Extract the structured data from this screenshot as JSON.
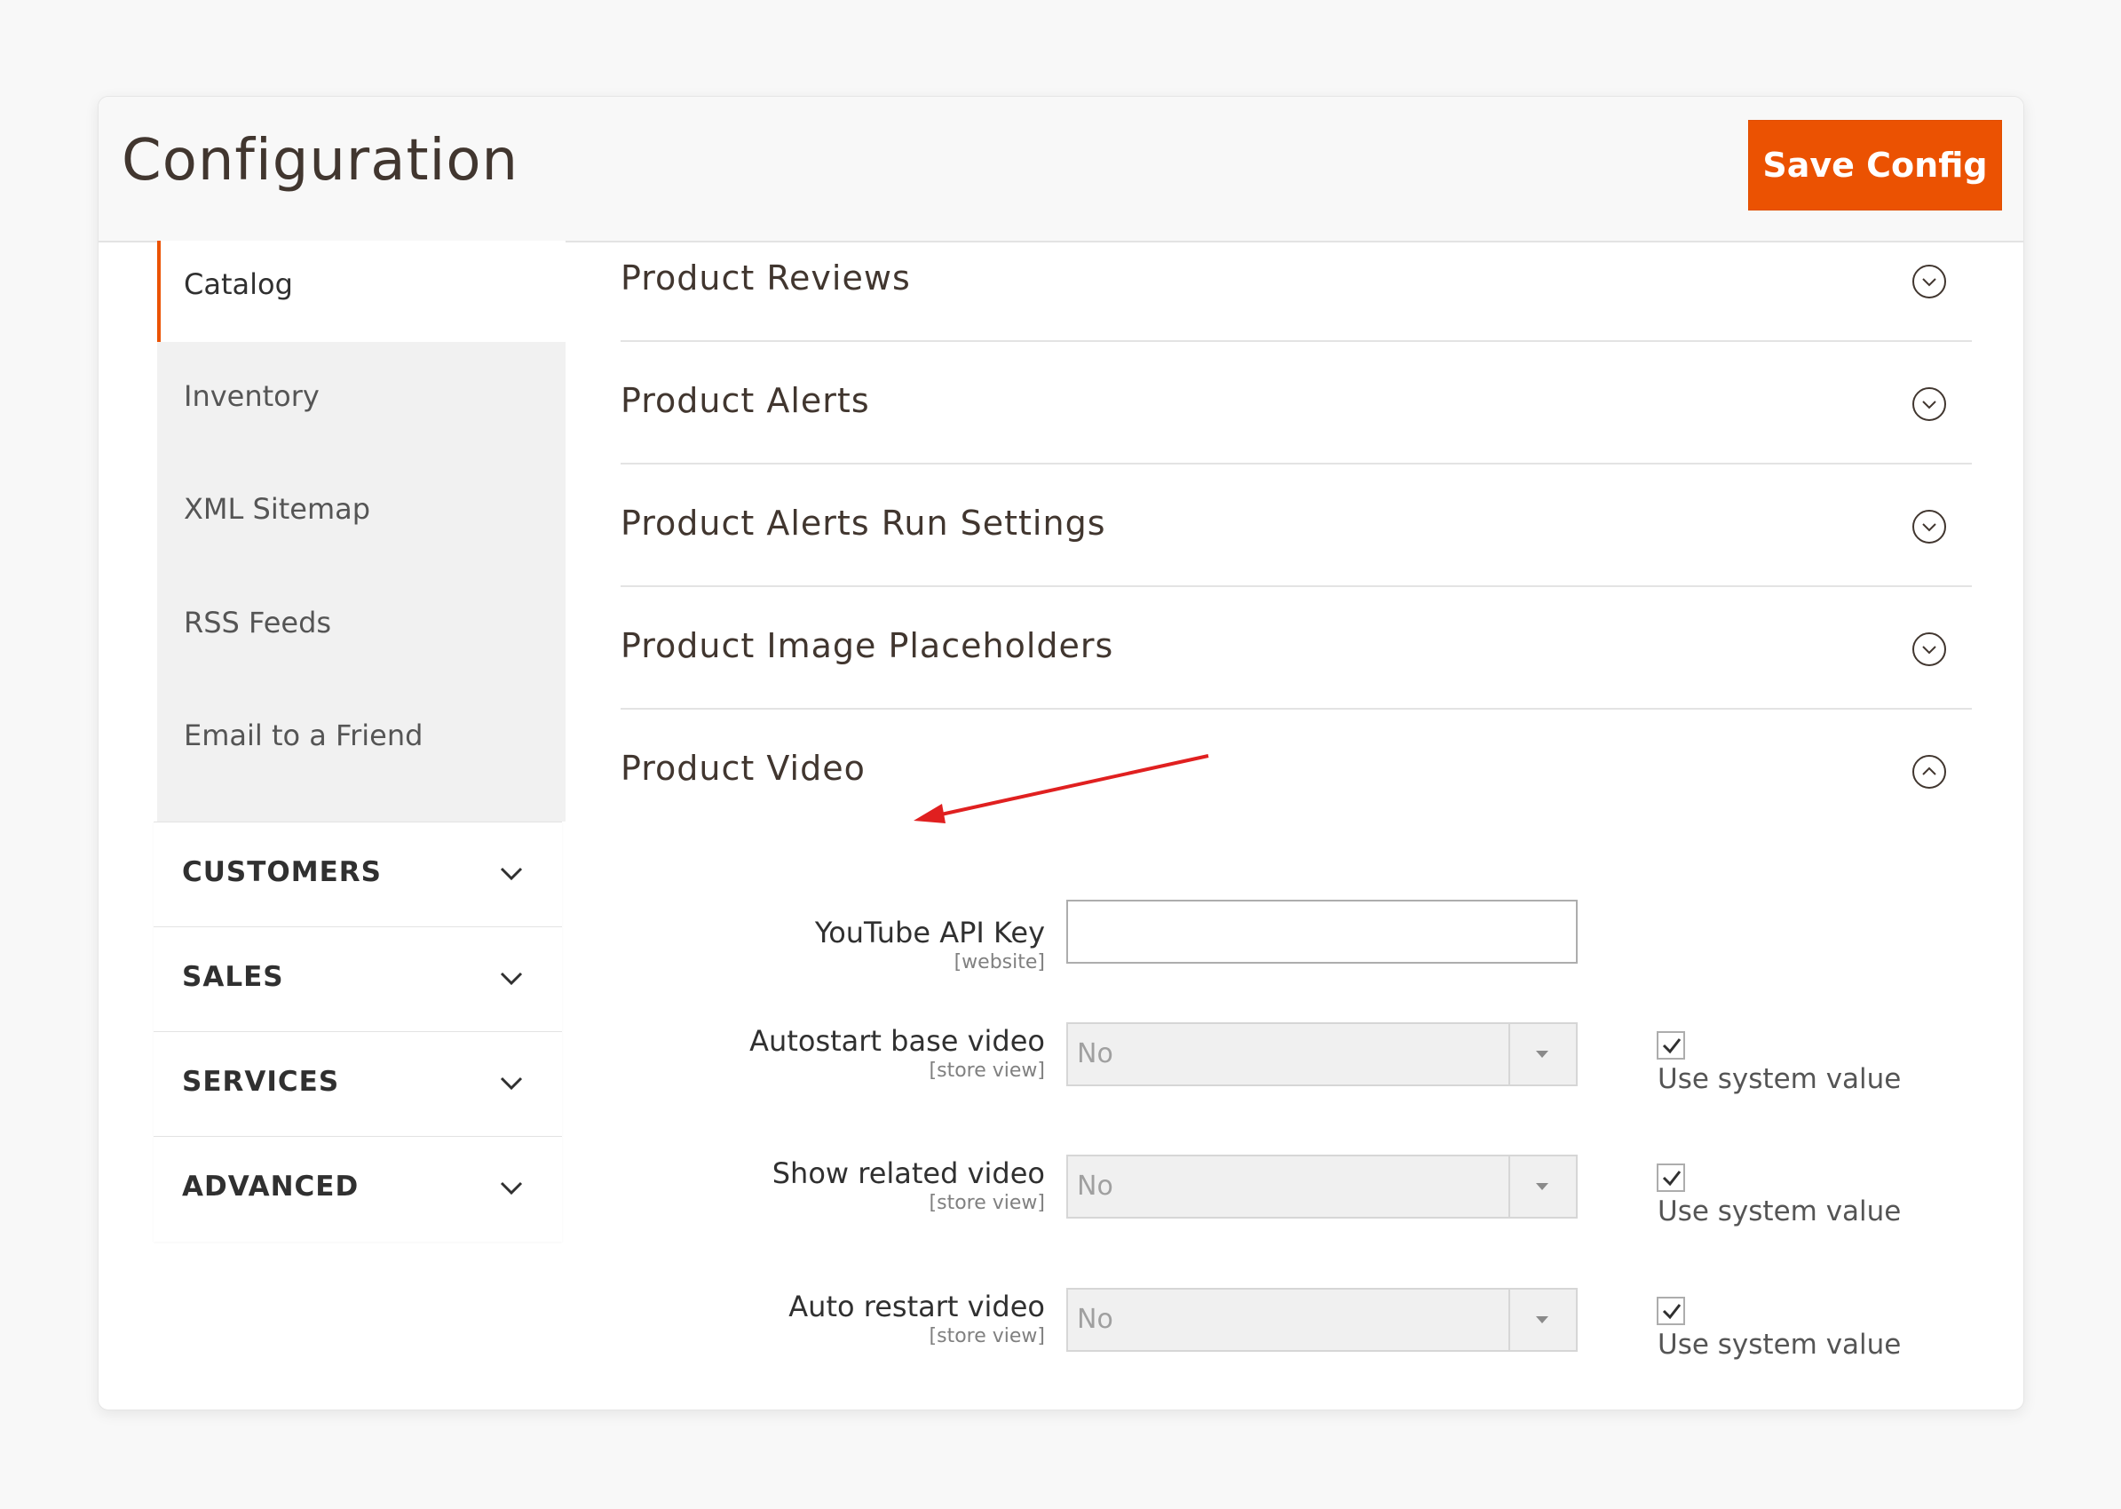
{
  "header": {
    "title": "Configuration",
    "save_label": "Save Config"
  },
  "sidebar": {
    "active_item": "Catalog",
    "sub_items": [
      "Inventory",
      "XML Sitemap",
      "RSS Feeds",
      "Email to a Friend"
    ],
    "sections": [
      "CUSTOMERS",
      "SALES",
      "SERVICES",
      "ADVANCED"
    ]
  },
  "groups": [
    {
      "title": "Product Reviews",
      "expanded": false
    },
    {
      "title": "Product Alerts",
      "expanded": false
    },
    {
      "title": "Product Alerts Run Settings",
      "expanded": false
    },
    {
      "title": "Product Image Placeholders",
      "expanded": false
    },
    {
      "title": "Product Video",
      "expanded": true
    }
  ],
  "product_video": {
    "fields": [
      {
        "label": "YouTube API Key",
        "scope": "[website]",
        "type": "text",
        "value": ""
      },
      {
        "label": "Autostart base video",
        "scope": "[store view]",
        "type": "select",
        "value": "No",
        "use_system_value": true
      },
      {
        "label": "Show related video",
        "scope": "[store view]",
        "type": "select",
        "value": "No",
        "use_system_value": true
      },
      {
        "label": "Auto restart video",
        "scope": "[store view]",
        "type": "select",
        "value": "No",
        "use_system_value": true
      }
    ],
    "use_system_label": "Use system value"
  },
  "colors": {
    "accent": "#eb5202",
    "annotation_arrow": "#e02020"
  },
  "icons": {
    "group_toggle_collapsed": "circle-chevron-down-icon",
    "group_toggle_expanded": "circle-chevron-up-icon",
    "section_toggle": "chevron-down-icon"
  }
}
